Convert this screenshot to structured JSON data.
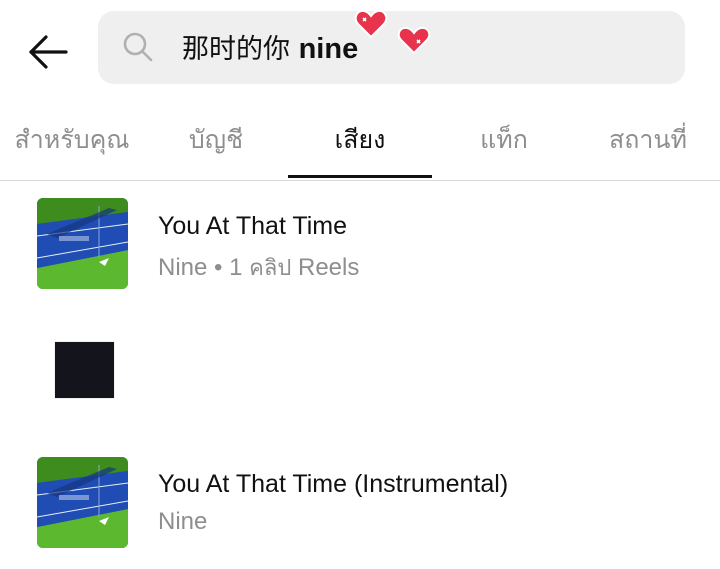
{
  "header": {
    "back_icon": "arrow-left-icon",
    "search": {
      "icon": "search-icon",
      "query_cjk": "那时的你",
      "query_latin": "nine"
    },
    "sticker_icons": [
      "heart-sticker-icon",
      "heart-sticker-icon"
    ]
  },
  "tabs": [
    {
      "label": "สำหรับคุณ",
      "active": false
    },
    {
      "label": "บัญชี",
      "active": false
    },
    {
      "label": "เสียง",
      "active": true
    },
    {
      "label": "แท็ก",
      "active": false
    },
    {
      "label": "สถานที่",
      "active": false
    }
  ],
  "results": [
    {
      "title": "You At That Time",
      "artist": "Nine",
      "separator": "•",
      "reels_count": "1",
      "reels_word": "คลิป",
      "reels_suffix": "Reels"
    },
    {
      "title": "",
      "artist": ""
    },
    {
      "title": "You At That Time (Instrumental)",
      "artist": "Nine"
    }
  ],
  "colors": {
    "accent_heart": "#e8334d",
    "text_primary": "#111111",
    "text_secondary": "#8e8e8e",
    "search_bg": "#efefef",
    "cover_blue": "#1e4fb5",
    "cover_green": "#5cb82e"
  }
}
